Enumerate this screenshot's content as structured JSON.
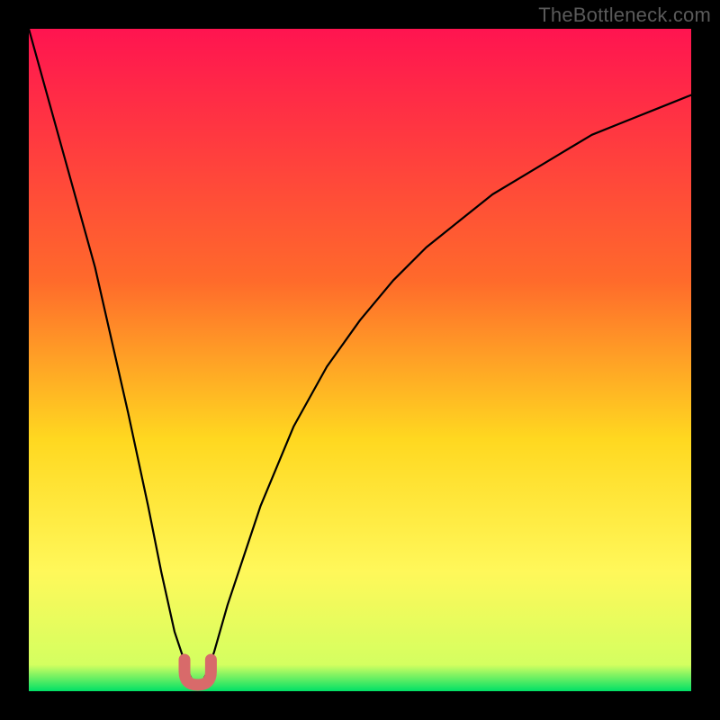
{
  "watermark": "TheBottleneck.com",
  "colors": {
    "background": "#000000",
    "gradient_top": "#ff1450",
    "gradient_mid1": "#ff6a2b",
    "gradient_mid2": "#ffd820",
    "gradient_mid3": "#fff85a",
    "gradient_bottom": "#00e066",
    "curve": "#000000",
    "marker": "#d86a6a"
  },
  "chart_data": {
    "type": "line",
    "title": "",
    "xlabel": "",
    "ylabel": "",
    "xlim": [
      0,
      100
    ],
    "ylim": [
      0,
      100
    ],
    "series": [
      {
        "name": "bottleneck-curve",
        "x": [
          0,
          5,
          10,
          15,
          18,
          20,
          22,
          24,
          25,
          26,
          27,
          28,
          30,
          35,
          40,
          45,
          50,
          55,
          60,
          65,
          70,
          75,
          80,
          85,
          90,
          95,
          100
        ],
        "y": [
          100,
          82,
          64,
          42,
          28,
          18,
          9,
          3,
          1,
          1,
          3,
          6,
          13,
          28,
          40,
          49,
          56,
          62,
          67,
          71,
          75,
          78,
          81,
          84,
          86,
          88,
          90
        ]
      }
    ],
    "markers": [
      {
        "name": "optimal-range",
        "x_range": [
          23.5,
          27.5
        ],
        "y": 0
      }
    ]
  }
}
